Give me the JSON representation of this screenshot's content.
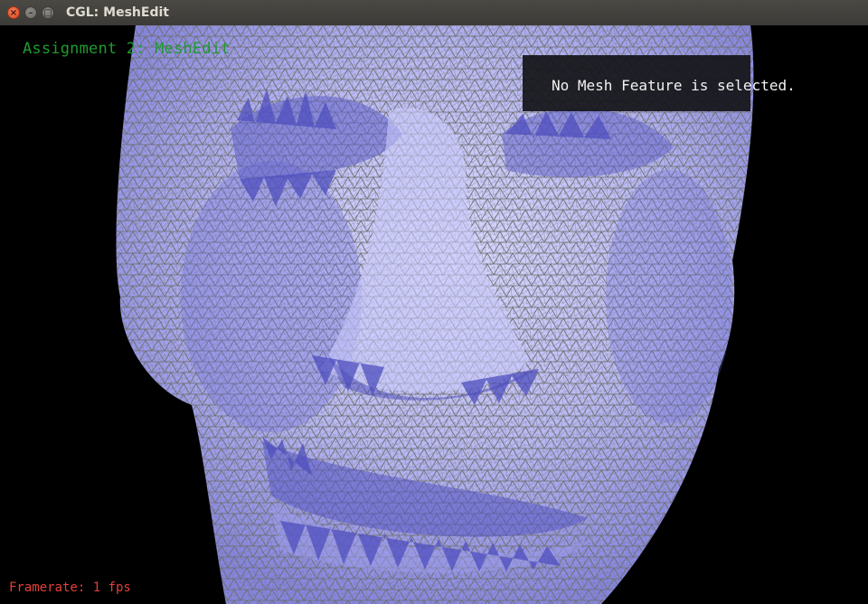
{
  "window": {
    "title": "CGL: MeshEdit",
    "close_glyph": "×",
    "minimize_glyph": "–",
    "maximize_glyph": "□"
  },
  "app": {
    "title": "Assignment 2: MeshEdit"
  },
  "info_panel": {
    "text": "No Mesh Feature is selected."
  },
  "status": {
    "framerate": "Framerate: 1 fps"
  },
  "colors": {
    "title_text": "#1f9a2f",
    "framerate_text": "#e0403a",
    "mesh_fill": "#b8b8f5",
    "mesh_wire": "#6b6b6b",
    "background": "#000000"
  }
}
